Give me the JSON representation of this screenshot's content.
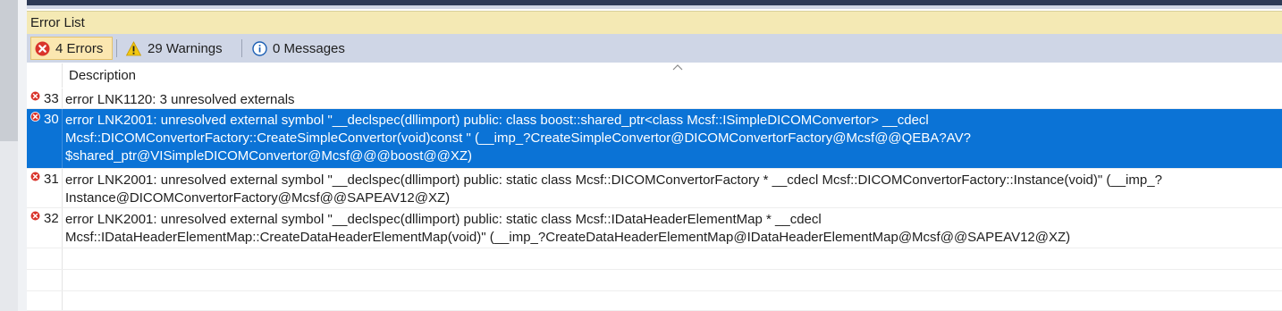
{
  "panel": {
    "title": "Error List"
  },
  "filters": {
    "errors": {
      "icon": "error-icon",
      "label": "4 Errors"
    },
    "warnings": {
      "icon": "warning-icon",
      "label": "29 Warnings"
    },
    "messages": {
      "icon": "info-icon",
      "label": "0 Messages"
    }
  },
  "columns": {
    "description": "Description"
  },
  "rows": [
    {
      "num": "33",
      "text": "error LNK1120: 3 unresolved externals",
      "selected": false
    },
    {
      "num": "30",
      "text": "error LNK2001: unresolved external symbol \"__declspec(dllimport) public: class boost::shared_ptr<class Mcsf::ISimpleDICOMConvertor> __cdecl\nMcsf::DICOMConvertorFactory::CreateSimpleConvertor(void)const \" (__imp_?CreateSimpleConvertor@DICOMConvertorFactory@Mcsf@@QEBA?AV?\n$shared_ptr@VISimpleDICOMConvertor@Mcsf@@@boost@@XZ)",
      "selected": true
    },
    {
      "num": "31",
      "text": "error LNK2001: unresolved external symbol \"__declspec(dllimport) public: static class Mcsf::DICOMConvertorFactory * __cdecl Mcsf::DICOMConvertorFactory::Instance(void)\" (__imp_?\nInstance@DICOMConvertorFactory@Mcsf@@SAPEAV12@XZ)",
      "selected": false
    },
    {
      "num": "32",
      "text": "error LNK2001: unresolved external symbol \"__declspec(dllimport) public: static class Mcsf::IDataHeaderElementMap * __cdecl\nMcsf::IDataHeaderElementMap::CreateDataHeaderElementMap(void)\" (__imp_?CreateDataHeaderElementMap@IDataHeaderElementMap@Mcsf@@SAPEAV12@XZ)",
      "selected": false
    }
  ],
  "colors": {
    "selection": "#0b73d6",
    "error": "#d9342b",
    "warning": "#f2c811",
    "info": "#1c5fb4",
    "titlebar": "#f4e9b4"
  }
}
